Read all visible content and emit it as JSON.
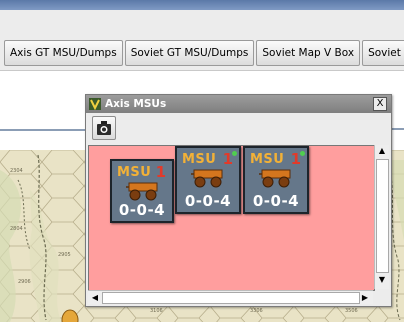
{
  "toolbar": {
    "buttons": [
      {
        "label": "Axis GT MSU/Dumps"
      },
      {
        "label": "Soviet GT MSU/Dumps"
      },
      {
        "label": "Soviet Map V Box"
      },
      {
        "label": "Soviet N"
      }
    ]
  },
  "map": {
    "hex_labels": [
      "2304",
      "2804",
      "2905",
      "2906",
      "3106",
      "3306",
      "3506"
    ]
  },
  "window": {
    "title": "Axis MSUs",
    "close_label": "X",
    "pane_color": "#ff9e9e"
  },
  "counters": [
    {
      "type": "MSU",
      "number": "1",
      "factors": "0-0-4"
    },
    {
      "type": "MSU",
      "number": "1",
      "factors": "0-0-4"
    },
    {
      "type": "MSU",
      "number": "1",
      "factors": "0-0-4"
    }
  ],
  "icons": [
    "app-v-icon",
    "camera-icon",
    "close-icon",
    "wagon-icon",
    "scroll-up-icon",
    "scroll-down-icon",
    "scroll-left-icon",
    "scroll-right-icon"
  ]
}
